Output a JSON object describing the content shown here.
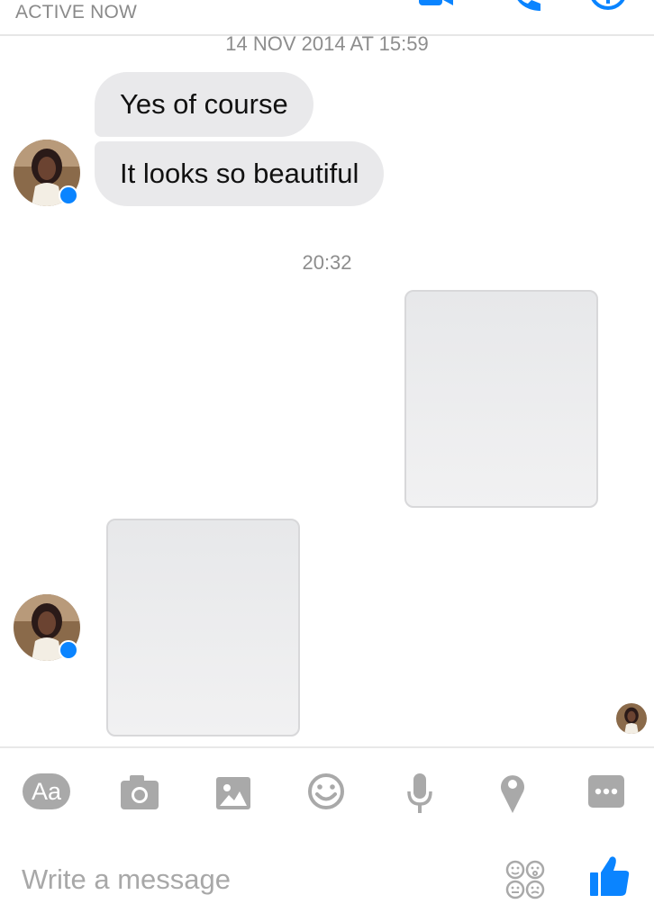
{
  "header": {
    "status": "ACTIVE NOW"
  },
  "conversation": {
    "timestamp_1": "14 NOV 2014 AT 15:59",
    "messages": [
      "Yes of course",
      "It looks so beautiful"
    ],
    "timestamp_2": "20:32"
  },
  "toolbar": {
    "text_button_label": "Aa"
  },
  "composer": {
    "placeholder": "Write a message"
  },
  "colors": {
    "accent": "#0a84ff",
    "bubble": "#e9e9eb",
    "icon_gray": "#a9a9a9"
  }
}
